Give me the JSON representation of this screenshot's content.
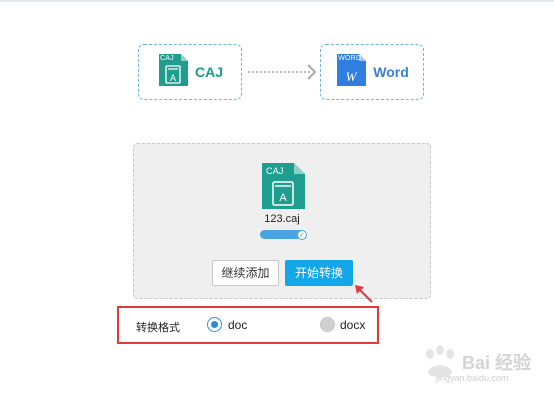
{
  "conversion": {
    "source": {
      "tag": "CAJ",
      "name": "CAJ",
      "icon": "caj-file-icon"
    },
    "target": {
      "tag": "WORD",
      "name": "Word",
      "icon": "word-file-icon",
      "letter": "W"
    }
  },
  "upload": {
    "file": {
      "tag": "CAJ",
      "glyph": "A",
      "name": "123.caj",
      "progress": 1.0
    },
    "buttons": {
      "add_label": "继续添加",
      "start_label": "开始转换"
    }
  },
  "format_options": {
    "label": "转换格式",
    "options": [
      {
        "label": "doc",
        "checked": true
      },
      {
        "label": "docx",
        "checked": false
      }
    ]
  },
  "watermark": {
    "text": "Bai 经验",
    "sub": "jingyan.baidu.com"
  },
  "colors": {
    "caj_teal": "#1b9b8c",
    "word_blue": "#3a7fd5",
    "primary_button": "#13a7e9",
    "annotation_red": "#e03a3a"
  }
}
